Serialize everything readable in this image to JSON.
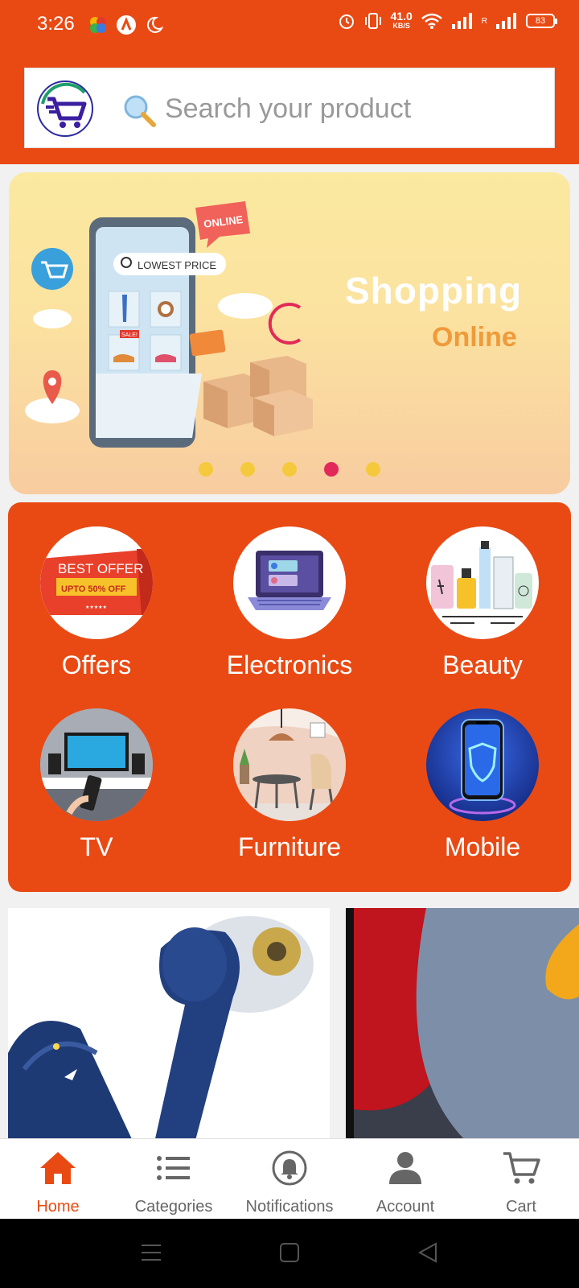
{
  "status_bar": {
    "time": "3:26",
    "net_speed_value": "41.0",
    "net_speed_unit": "KB/S",
    "roaming": "R",
    "battery": "83"
  },
  "search": {
    "placeholder": "Search your product"
  },
  "banner": {
    "tag_online": "ONLINE",
    "lowest_price": "LOWEST PRICE",
    "sale_tag": "SALE!",
    "title": "Shopping",
    "subtitle": "Online",
    "slide_count": 5,
    "active_slide": 4
  },
  "categories": [
    {
      "label": "Offers",
      "badge_line1": "BEST OFFER",
      "badge_line2": "UPTO 50% OFF"
    },
    {
      "label": "Electronics"
    },
    {
      "label": "Beauty"
    },
    {
      "label": "TV"
    },
    {
      "label": "Furniture"
    },
    {
      "label": "Mobile"
    }
  ],
  "bottom_nav": [
    {
      "label": "Home",
      "icon": "home-icon",
      "active": true
    },
    {
      "label": "Categories",
      "icon": "list-icon",
      "active": false
    },
    {
      "label": "Notifications",
      "icon": "bell-icon",
      "active": false
    },
    {
      "label": "Account",
      "icon": "person-icon",
      "active": false
    },
    {
      "label": "Cart",
      "icon": "cart-icon",
      "active": false
    }
  ],
  "colors": {
    "brand": "#e94a14",
    "active_dot": "#e22a5a",
    "inactive_dot": "#f5c93c",
    "banner_subtitle": "#f09a3a"
  }
}
